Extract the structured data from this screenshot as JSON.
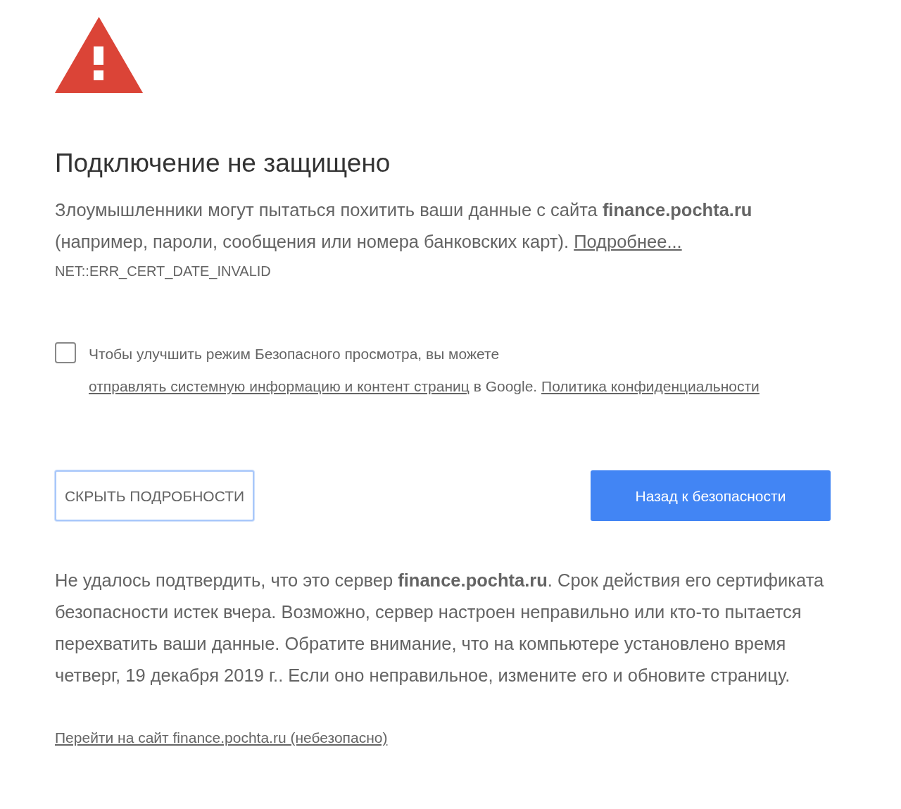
{
  "heading": "Подключение не защищено",
  "description": [
    {
      "kind": "text",
      "text": "Злоумышленники могут пытаться похитить ваши данные с сайта **finance.pochta.ru** (например, пароли, сообщения или номера банковских карт). "
    },
    {
      "kind": "link",
      "text": "Подробнее..."
    }
  ],
  "error_code": "NET::ERR_CERT_DATE_INVALID",
  "checkbox": {
    "checked": false,
    "segments": [
      {
        "kind": "text",
        "text": "Чтобы улучшить режим Безопасного просмотра, вы можете "
      },
      {
        "kind": "link",
        "text": "отправлять системную информацию и контент страниц"
      },
      {
        "kind": "text",
        "text": " в Google. "
      },
      {
        "kind": "link",
        "text": "Политика конфиденциальности"
      }
    ]
  },
  "buttons": [
    {
      "kind": "secondary",
      "label": "СКРЫТЬ ПОДРОБНОСТИ",
      "focused": true
    },
    {
      "kind": "primary",
      "label": "Назад к безопасности",
      "focused": false
    }
  ],
  "details_text": "Не удалось подтвердить, что это сервер **finance.pochta.ru**. Срок действия его сертификата безопасности истек вчера. Возможно, сервер настроен неправильно или кто-то пытается перехватить ваши данные. Обратите внимание, что на компьютере установлено время четверг, 19 декабря 2019 г.. Если оно неправильное, измените его и обновите страницу.",
  "proceed_link": "Перейти на сайт finance.pochta.ru (небезопасно)"
}
